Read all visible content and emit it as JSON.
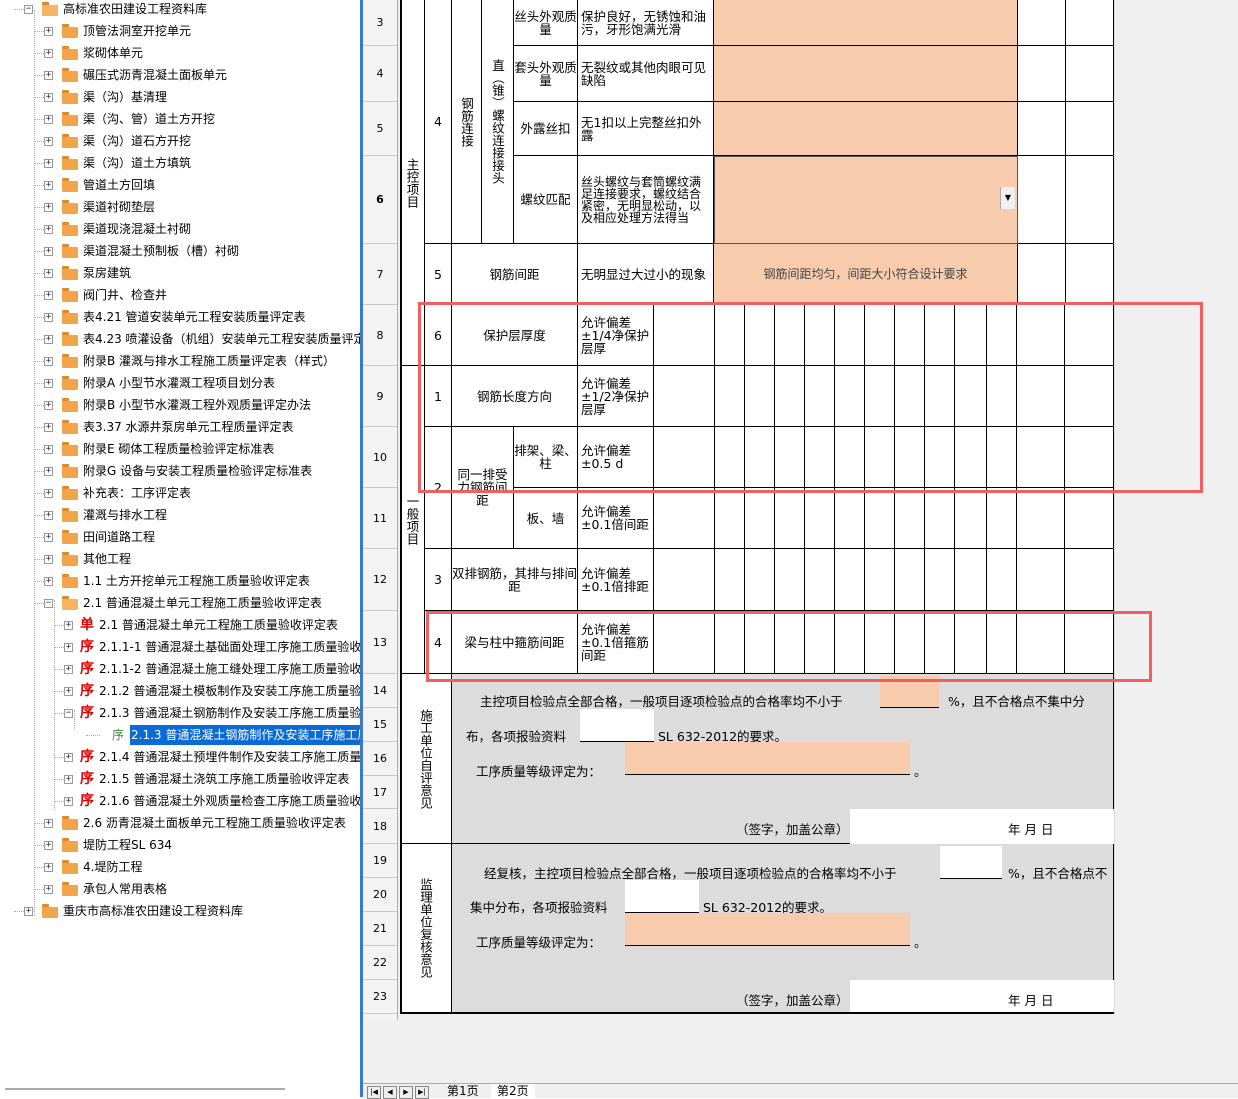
{
  "tree": {
    "items": [
      {
        "label": "高标准农田建设工程资料库",
        "level": 0,
        "state": "open",
        "kind": "folder"
      },
      {
        "label": "顶管法洞室开挖单元",
        "level": 1,
        "state": "closed",
        "kind": "folder"
      },
      {
        "label": "浆砌体单元",
        "level": 1,
        "state": "closed",
        "kind": "folder"
      },
      {
        "label": "碾压式沥青混凝土面板单元",
        "level": 1,
        "state": "closed",
        "kind": "folder"
      },
      {
        "label": "渠（沟）基清理",
        "level": 1,
        "state": "closed",
        "kind": "folder"
      },
      {
        "label": "渠（沟、管）道土方开挖",
        "level": 1,
        "state": "closed",
        "kind": "folder"
      },
      {
        "label": "渠（沟）道石方开挖",
        "level": 1,
        "state": "closed",
        "kind": "folder"
      },
      {
        "label": "渠（沟）道土方填筑",
        "level": 1,
        "state": "closed",
        "kind": "folder"
      },
      {
        "label": "管道土方回填",
        "level": 1,
        "state": "closed",
        "kind": "folder"
      },
      {
        "label": "渠道衬砌垫层",
        "level": 1,
        "state": "closed",
        "kind": "folder"
      },
      {
        "label": "渠道现浇混凝土衬砌",
        "level": 1,
        "state": "closed",
        "kind": "folder"
      },
      {
        "label": "渠道混凝土预制板（槽）衬砌",
        "level": 1,
        "state": "closed",
        "kind": "folder"
      },
      {
        "label": "泵房建筑",
        "level": 1,
        "state": "closed",
        "kind": "folder"
      },
      {
        "label": "阀门井、检查井",
        "level": 1,
        "state": "closed",
        "kind": "folder"
      },
      {
        "label": "表4.21 管道安装单元工程安装质量评定表",
        "level": 1,
        "state": "closed",
        "kind": "folder"
      },
      {
        "label": "表4.23 喷灌设备（机组）安装单元工程安装质量评定",
        "level": 1,
        "state": "closed",
        "kind": "folder"
      },
      {
        "label": "附录B 灌溉与排水工程施工质量评定表（样式）",
        "level": 1,
        "state": "closed",
        "kind": "folder"
      },
      {
        "label": "附录A 小型节水灌溉工程项目划分表",
        "level": 1,
        "state": "closed",
        "kind": "folder"
      },
      {
        "label": "附录B 小型节水灌溉工程外观质量评定办法",
        "level": 1,
        "state": "closed",
        "kind": "folder"
      },
      {
        "label": "表3.37 水源井泵房单元工程质量评定表",
        "level": 1,
        "state": "closed",
        "kind": "folder"
      },
      {
        "label": "附录E 砌体工程质量检验评定标准表",
        "level": 1,
        "state": "closed",
        "kind": "folder"
      },
      {
        "label": "附录G 设备与安装工程质量检验评定标准表",
        "level": 1,
        "state": "closed",
        "kind": "folder"
      },
      {
        "label": "补充表：工序评定表",
        "level": 1,
        "state": "closed",
        "kind": "folder"
      },
      {
        "label": "灌溉与排水工程",
        "level": 1,
        "state": "closed",
        "kind": "folder"
      },
      {
        "label": "田间道路工程",
        "level": 1,
        "state": "closed",
        "kind": "folder"
      },
      {
        "label": "其他工程",
        "level": 1,
        "state": "closed",
        "kind": "folder"
      },
      {
        "label": "1.1 土方开挖单元工程施工质量验收评定表",
        "level": 1,
        "state": "closed",
        "kind": "folder"
      },
      {
        "label": "2.1 普通混凝土单元工程施工质量验收评定表",
        "level": 1,
        "state": "open",
        "kind": "folder"
      },
      {
        "label": "2.1 普通混凝土单元工程施工质量验收评定表",
        "level": 2,
        "state": "closed",
        "kind": "unit",
        "badge": "单"
      },
      {
        "label": "2.1.1-1 普通混凝土基础面处理工序施工质量验收",
        "level": 2,
        "state": "closed",
        "kind": "seq",
        "badge": "序"
      },
      {
        "label": "2.1.1-2 普通混凝土施工缝处理工序施工质量验收",
        "level": 2,
        "state": "closed",
        "kind": "seq",
        "badge": "序"
      },
      {
        "label": "2.1.2 普通混凝土模板制作及安装工序施工质量验",
        "level": 2,
        "state": "closed",
        "kind": "seq",
        "badge": "序"
      },
      {
        "label": "2.1.3 普通混凝土钢筋制作及安装工序施工质量验",
        "level": 2,
        "state": "open",
        "kind": "seq",
        "badge": "序"
      },
      {
        "label": "2.1.3 普通混凝土钢筋制作及安装工序施工质",
        "level": 3,
        "state": "none",
        "kind": "page",
        "badge": "序",
        "selected": true
      },
      {
        "label": "2.1.4 普通混凝土预埋件制作及安装工序施工质量",
        "level": 2,
        "state": "closed",
        "kind": "seq",
        "badge": "序"
      },
      {
        "label": "2.1.5 普通混凝土浇筑工序施工质量验收评定表",
        "level": 2,
        "state": "closed",
        "kind": "seq",
        "badge": "序"
      },
      {
        "label": "2.1.6 普通混凝土外观质量检查工序施工质量验收",
        "level": 2,
        "state": "closed",
        "kind": "seq",
        "badge": "序"
      },
      {
        "label": "2.6 沥青混凝土面板单元工程施工质量验收评定表",
        "level": 1,
        "state": "closed",
        "kind": "folder"
      },
      {
        "label": "堤防工程SL 634",
        "level": 1,
        "state": "closed",
        "kind": "folder"
      },
      {
        "label": "4.堤防工程",
        "level": 1,
        "state": "closed",
        "kind": "folder"
      },
      {
        "label": "承包人常用表格",
        "level": 1,
        "state": "closed",
        "kind": "folder"
      },
      {
        "label": "重庆市高标准农田建设工程资料库",
        "level": 0,
        "state": "closed",
        "kind": "folder"
      }
    ]
  },
  "rows": [
    "3",
    "4",
    "5",
    "6",
    "7",
    "8",
    "9",
    "10",
    "11",
    "12",
    "13",
    "14",
    "15",
    "16",
    "17",
    "18",
    "19",
    "20",
    "21",
    "22",
    "23"
  ],
  "sheet": {
    "main_control": "主控项目",
    "general": "一般项目",
    "item4_no": "4",
    "rebar_conn": "钢筋连接",
    "thread_joint": "直（锥）螺纹连接接头",
    "r3_name": "丝头外观质量",
    "r3_std": "保护良好，无锈蚀和油污，牙形饱满光滑",
    "r4_name": "套头外观质量",
    "r4_std": "无裂纹或其他肉眼可见缺陷",
    "r5_name": "外露丝扣",
    "r5_std": "无1扣以上完整丝扣外露",
    "r6_name": "螺纹匹配",
    "r6_std": "丝头螺纹与套筒螺纹满足连接要求，螺纹结合紧密，无明显松动，以及相应处理方法得当",
    "r7_no": "5",
    "r7_name": "钢筋间距",
    "r7_std": "无明显过大过小的现象",
    "r7_result": "钢筋间距均匀，间距大小符合设计要求",
    "r8_no": "6",
    "r8_name": "保护层厚度",
    "r8_std": "允许偏差±1/4净保护层厚",
    "r9_no": "1",
    "r9_name": "钢筋长度方向",
    "r9_std": "允许偏差±1/2净保护层厚",
    "r10_no": "2",
    "r10_group": "同一排受力钢筋间距",
    "r10_sub": "排架、梁、柱",
    "r10_std": "允许偏差±0.5 d",
    "r11_sub": "板、墙",
    "r11_std": "允许偏差±0.1倍间距",
    "r12_no": "3",
    "r12_name": "双排钢筋，其排与排间距",
    "r12_std": "允许偏差±0.1倍排距",
    "r13_no": "4",
    "r13_name": "梁与柱中箍筋间距",
    "r13_std": "允许偏差±0.1倍箍筋间距",
    "self_eval": "施工单位自评意见",
    "se_line1a": "主控项目检验点全部合格，一般项目逐项检验点的合格率均不小于",
    "se_line1b": "%，且不合格点不集中分",
    "se_line2a": "布，各项报验资料",
    "se_line2b": "SL 632-2012的要求。",
    "se_line3": "工序质量等级评定为：",
    "period": "。",
    "sign": "（签字，加盖公章）",
    "ymd": "年  月  日",
    "supervisor": "监理单位复核意见",
    "sv_line1a": "经复核，主控项目检验点全部合格，一般项目逐项检验点的合格率均不小于",
    "sv_line1b": "%，且不合格点不",
    "sv_line2a": "集中分布，各项报验资料",
    "sv_line2b": "SL 632-2012的要求。",
    "sv_line3": "工序质量等级评定为："
  },
  "tabs": {
    "page1": "第1页",
    "page2": "第2页"
  },
  "colors": {
    "peach": "#f8cbad",
    "selection": "#0a6ad6",
    "annotation": "#f06060"
  }
}
